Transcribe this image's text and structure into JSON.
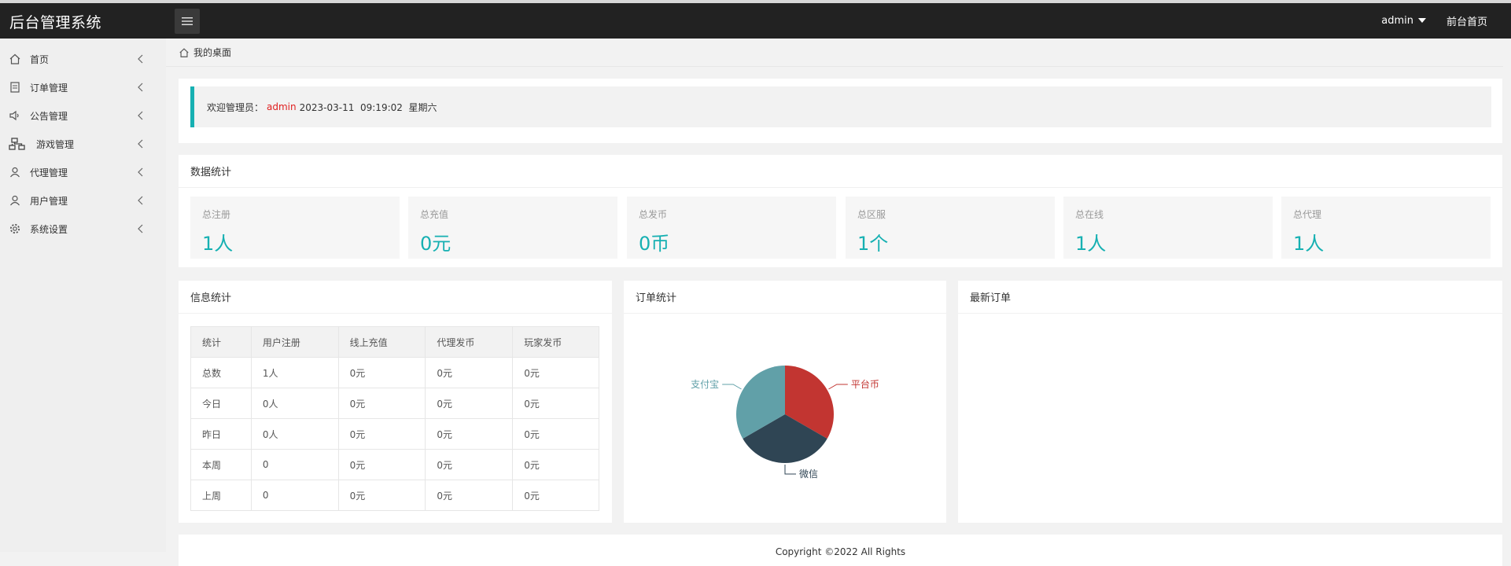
{
  "app": {
    "title": "后台管理系统"
  },
  "topbar": {
    "user": "admin",
    "frontend_link": "前台首页"
  },
  "sidebar": {
    "items": [
      {
        "label": "首页",
        "icon": "home-icon"
      },
      {
        "label": "订单管理",
        "icon": "document-icon"
      },
      {
        "label": "公告管理",
        "icon": "speaker-icon"
      },
      {
        "label": "游戏管理",
        "icon": "sitemap-icon"
      },
      {
        "label": "代理管理",
        "icon": "user-icon"
      },
      {
        "label": "用户管理",
        "icon": "user-icon"
      },
      {
        "label": "系统设置",
        "icon": "gear-icon"
      }
    ]
  },
  "breadcrumb": {
    "label": "我的桌面"
  },
  "welcome": {
    "prefix": "欢迎管理员：",
    "user": "admin",
    "datetime": "2023-03-11  09:19:02  星期六"
  },
  "stats": {
    "title": "数据统计",
    "items": [
      {
        "label": "总注册",
        "value": "1人"
      },
      {
        "label": "总充值",
        "value": "0元"
      },
      {
        "label": "总发币",
        "value": "0币"
      },
      {
        "label": "总区服",
        "value": "1个"
      },
      {
        "label": "总在线",
        "value": "1人"
      },
      {
        "label": "总代理",
        "value": "1人"
      }
    ]
  },
  "info": {
    "title": "信息统计",
    "headers": [
      "统计",
      "用户注册",
      "线上充值",
      "代理发币",
      "玩家发币"
    ],
    "rows": [
      [
        "总数",
        "1人",
        "0元",
        "0元",
        "0元"
      ],
      [
        "今日",
        "0人",
        "0元",
        "0元",
        "0元"
      ],
      [
        "昨日",
        "0人",
        "0元",
        "0元",
        "0元"
      ],
      [
        "本周",
        "0",
        "0元",
        "0元",
        "0元"
      ],
      [
        "上周",
        "0",
        "0元",
        "0元",
        "0元"
      ]
    ]
  },
  "orders": {
    "title": "订单统计",
    "chart_data": {
      "type": "pie",
      "categories": [
        "平台币",
        "微信",
        "支付宝"
      ],
      "values": [
        1,
        1,
        1
      ],
      "colors": [
        "#c23531",
        "#2f4554",
        "#61a0a8"
      ]
    }
  },
  "latest": {
    "title": "最新订单"
  },
  "footer": {
    "copyright": "Copyright ©2022 All Rights"
  }
}
